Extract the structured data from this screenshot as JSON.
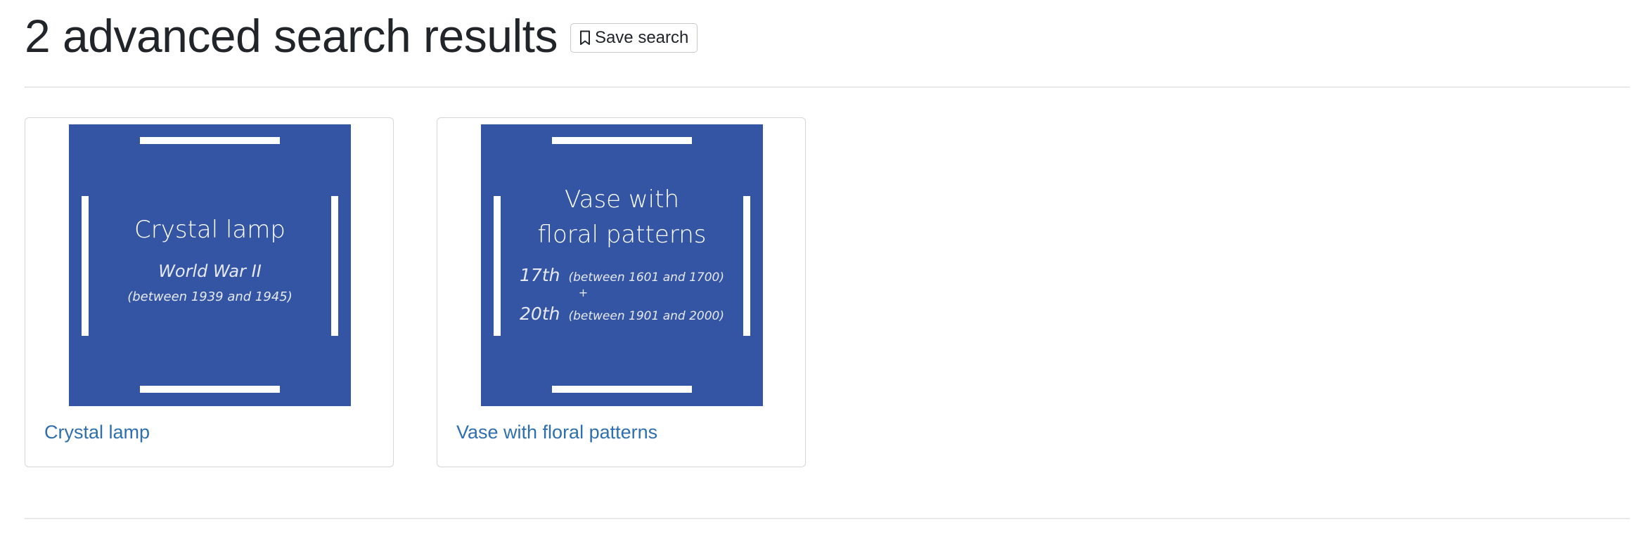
{
  "header": {
    "title": "2 advanced search results",
    "save_label": "Save search"
  },
  "results": [
    {
      "thumbnail": {
        "title": "Crystal lamp",
        "era": "World War II",
        "range": "(between 1939 and 1945)"
      },
      "link_label": "Crystal lamp"
    },
    {
      "thumbnail": {
        "title_line1": "Vase with",
        "title_line2": "floral patterns",
        "century1": "17th",
        "range1": "(between 1601 and 1700)",
        "plus": "+",
        "century2": "20th",
        "range2": "(between 1901 and 2000)"
      },
      "link_label": "Vase with floral patterns"
    }
  ],
  "colors": {
    "thumb_bg": "#3355a3",
    "link": "#2f6fae"
  }
}
